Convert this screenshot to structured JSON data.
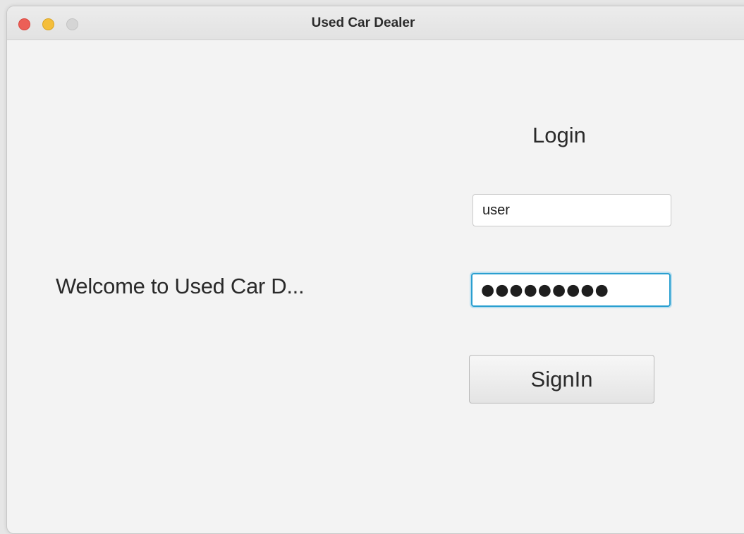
{
  "window": {
    "title": "Used Car Dealer",
    "traffic_lights": {
      "close": "#ec5f57",
      "minimize": "#f4be3b",
      "zoom": "#d5d5d5"
    }
  },
  "main": {
    "welcome_text": "Welcome to Used Car D...",
    "login_title": "Login",
    "username_value": "user",
    "password_value": "●●●●●●●●●",
    "signin_label": "SignIn"
  },
  "colors": {
    "focus_border": "#2a9fd0",
    "background": "#f3f3f3"
  }
}
